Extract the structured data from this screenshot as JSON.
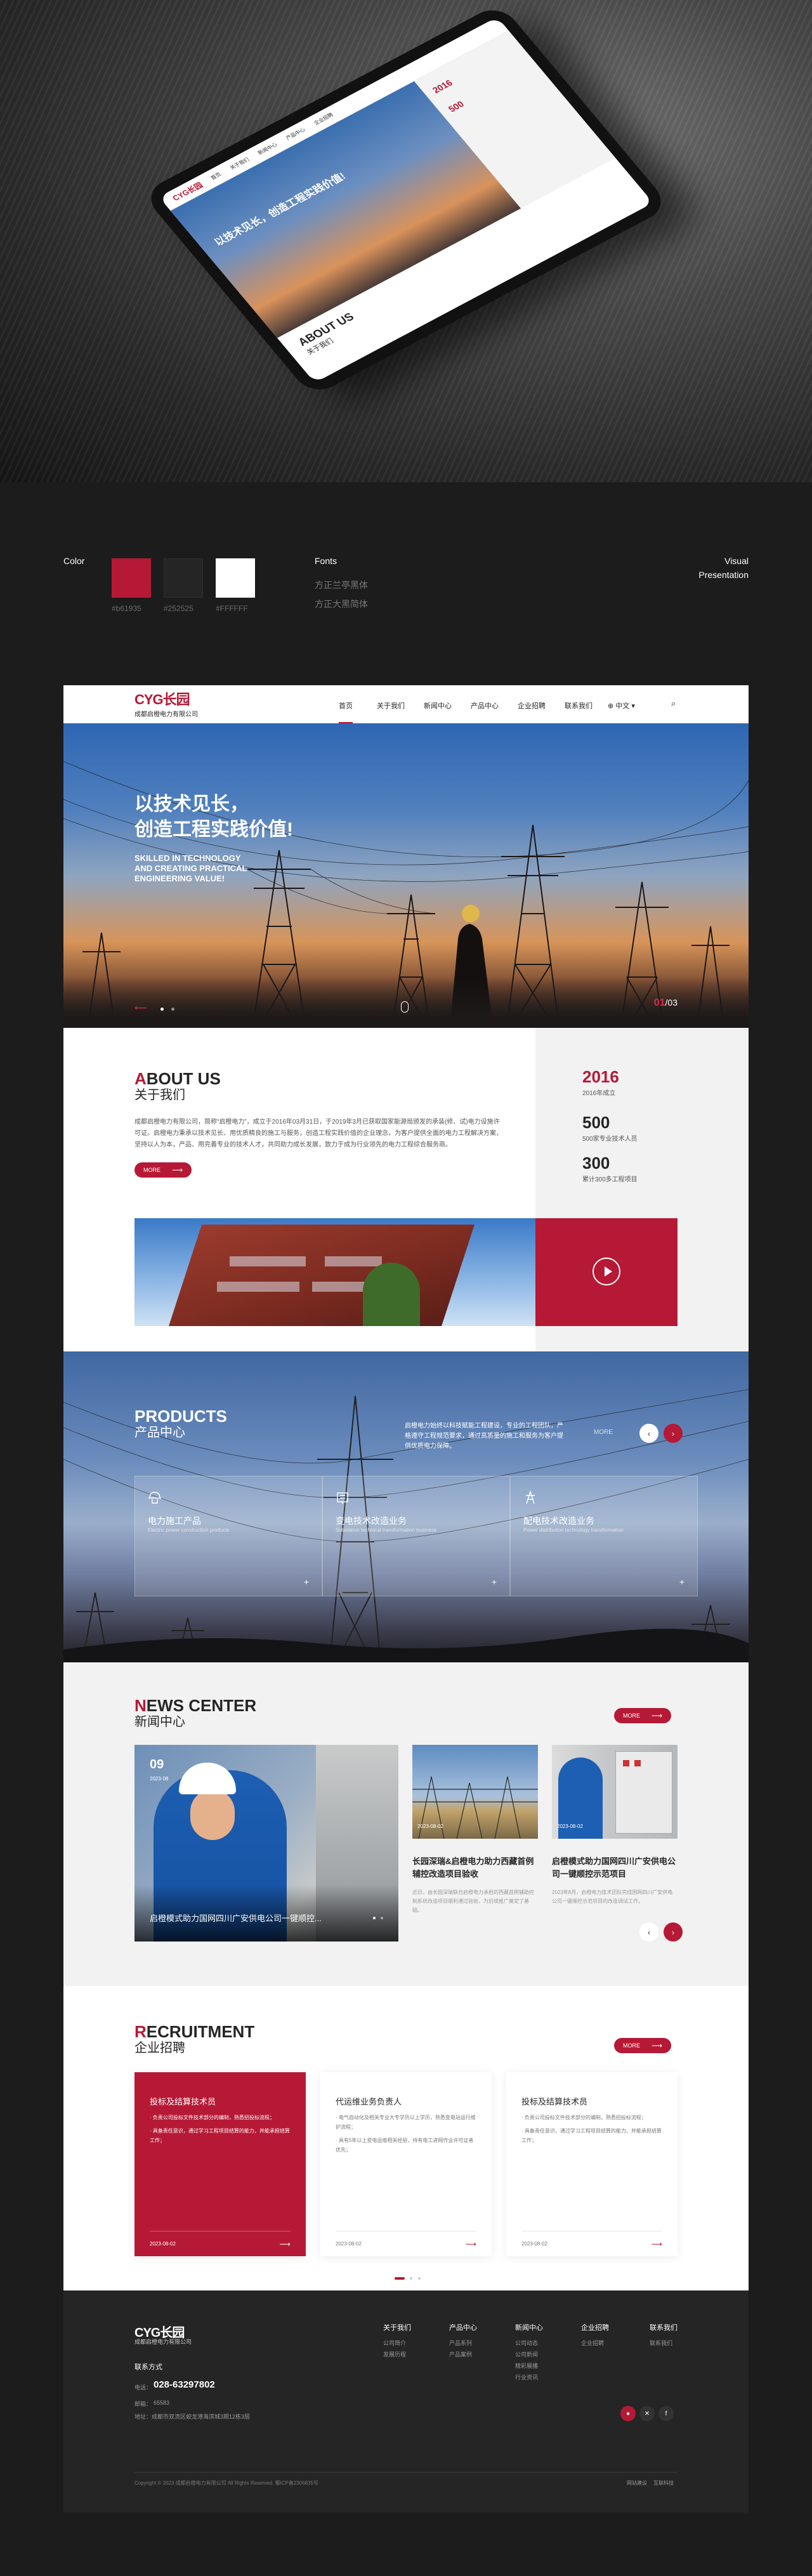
{
  "mockup": {
    "nav_logo": "CYG长园",
    "banner_title": "以技术见长，创造工程实践价值!",
    "side_year": "2016",
    "side_stat": "500",
    "about_en": "ABOUT US",
    "about_cn": "关于我们"
  },
  "guide": {
    "color_label": "Color",
    "fonts_label": "Fonts",
    "visual_label_1": "Visual",
    "visual_label_2": "Presentation",
    "swatches": [
      {
        "hex": "#b61935",
        "label": "#b61935"
      },
      {
        "hex": "#252525",
        "label": "#252525"
      },
      {
        "hex": "#FFFFFF",
        "label": "#FFFFFF"
      }
    ],
    "fonts": [
      "方正兰亭黑体",
      "方正大黑简体"
    ]
  },
  "site": {
    "logo_mark": "CYG长园",
    "logo_company": "成都启橙电力有限公司",
    "nav": [
      "首页",
      "关于我们",
      "新闻中心",
      "产品中心",
      "企业招聘",
      "联系我们",
      "中文"
    ],
    "banner": {
      "title_1": "以技术见长，",
      "title_2": "创造工程实践价值!",
      "en_1": "SKILLED IN TECHNOLOGY",
      "en_2": "AND CREATING PRACTICAL",
      "en_3": "ENGINEERING VALUE!",
      "page_current": "01",
      "page_total": "/03"
    },
    "about": {
      "title_first": "A",
      "title_rest": "BOUT US",
      "title_cn": "关于我们",
      "text": "成都启橙电力有限公司，简称“启橙电力”，成立于2016年03月31日，于2019年3月已获取国家能源局颁发的承装(修、试)电力设施许可证。启橙电力秉承以技术见长、用优质精良的施工与服务，创造工程实践价值的企业理念，为客户提供全面的电力工程解决方案，坚持以人为本，产品、用完善专业的技术人才，共同助力成长发展，致力于成为行业领先的电力工程综合服务商。",
      "more": "MORE",
      "stats": [
        {
          "value": "2016",
          "desc": "2016年成立"
        },
        {
          "value": "500",
          "desc": "500家专业技术人员"
        },
        {
          "value": "300",
          "desc": "累计300多工程项目"
        }
      ]
    },
    "products": {
      "title": "PRODUCTS",
      "title_cn": "产品中心",
      "desc": "启橙电力始终以科技赋能工程建设，专业的工程团队，严格遵守工程规范要求，通过高质量的施工和服务为客户提供优质电力保障。",
      "more": "MORE",
      "cards": [
        {
          "title": "电力施工产品",
          "en": "Electric power construction products"
        },
        {
          "title": "变电技术改造业务",
          "en": "Substation technical transformation business"
        },
        {
          "title": "配电技术改造业务",
          "en": "Power distribution technology transformation"
        }
      ]
    },
    "news": {
      "title_first": "N",
      "title_rest": "EWS CENTER",
      "title_cn": "新闻中心",
      "more": "MORE",
      "big": {
        "day": "09",
        "date": "2023-08",
        "title": "启橙模式助力国网四川广安供电公司一键顺控..."
      },
      "items": [
        {
          "date": "2023-08-02",
          "title": "长园深瑞&启橙电力助力西藏首例辅控改造项目验收",
          "excerpt": "近日，由长园深瑞联合启橙电力承担的西藏首例辅助控制系统改造项目顺利通过验收，为后续推广奠定了基础。"
        },
        {
          "date": "2023-08-02",
          "title": "启橙模式助力国网四川广安供电公司一键顺控示范项目",
          "excerpt": "2023年8月，启橙电力技术团队完成国网四川广安供电公司一键顺控示范项目的改造调试工作。"
        }
      ]
    },
    "recruit": {
      "title_first": "R",
      "title_rest": "ECRUITMENT",
      "title_cn": "企业招聘",
      "more": "MORE",
      "jobs": [
        {
          "title": "投标及结算技术员",
          "line1": "· 负责公司投标文件技术部分的编制，熟悉招投标流程；",
          "line2": "· 具备责任意识，通过学习工程项目结算的能力，并能承担结算工作；",
          "date": "2023-08-02"
        },
        {
          "title": "代运维业务负责人",
          "line1": "· 电气自动化及相关专业大专学历以上学历，熟悉变电站运行维护流程；",
          "line2": "· 具有5年以上变电运维相关经验，持有电工进网作业许可证者优先；",
          "date": "2023-08-02"
        },
        {
          "title": "投标及结算技术员",
          "line1": "· 负责公司投标文件技术部分的编制，熟悉招投标流程；",
          "line2": "· 具备责任意识，通过学习工程项目结算的能力，并能承担结算工作；",
          "date": "2023-08-02"
        }
      ]
    },
    "footer": {
      "logo_mark": "CYG长园",
      "company": "成都启橙电力有限公司",
      "contact_label": "联系方式",
      "phone_label": "电话：",
      "phone": "028-63297802",
      "mail_label": "邮箱：",
      "mail": "65583",
      "addr": "地址：成都市双流区蛟龙港海滨城3期12栋3层",
      "cols": [
        {
          "h": "关于我们",
          "items": [
            "公司简介",
            "发展历程"
          ]
        },
        {
          "h": "产品中心",
          "items": [
            "产品系列",
            "产品案例"
          ]
        },
        {
          "h": "新闻中心",
          "items": [
            "公司动态",
            "公司新闻",
            "精彩展播",
            "行业资讯"
          ]
        },
        {
          "h": "企业招聘",
          "items": [
            "企业招聘"
          ]
        },
        {
          "h": "联系我们",
          "items": [
            "联系我们"
          ]
        }
      ],
      "copyright": "Copyright © 2023 成都启橙电力有限公司 All Rights Reserved.  蜀ICP备2306835号",
      "links": [
        "网站建设",
        "互联科技"
      ]
    }
  }
}
